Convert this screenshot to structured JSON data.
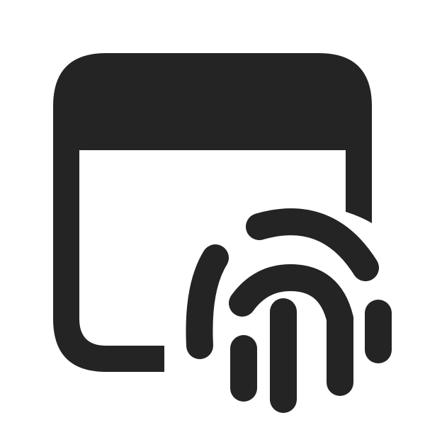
{
  "icon": {
    "name": "app-window-fingerprint-icon",
    "color": "#242424",
    "background": "#ffffff"
  }
}
